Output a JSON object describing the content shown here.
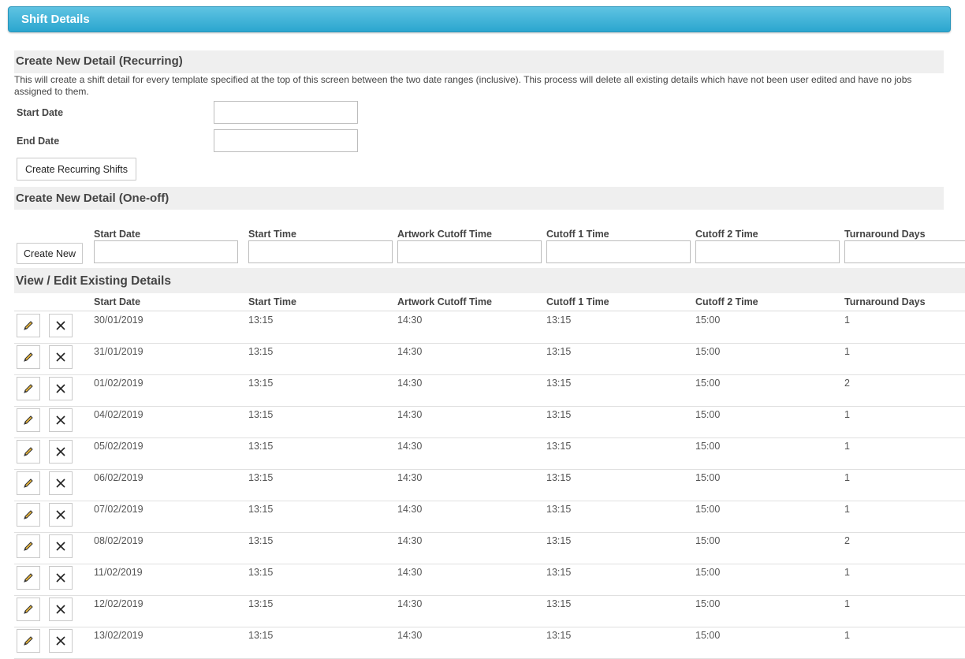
{
  "header": {
    "title": "Shift Details"
  },
  "recurring": {
    "title": "Create New Detail (Recurring)",
    "description": "This will create a shift detail for every template specified at the top of this screen between the two date ranges (inclusive). This process will delete all existing details which have not been user edited and have no jobs assigned to them.",
    "start_date_label": "Start Date",
    "end_date_label": "End Date",
    "start_date_value": "",
    "end_date_value": "",
    "create_button": "Create Recurring Shifts"
  },
  "oneoff": {
    "title": "Create New Detail (One-off)",
    "create_button": "Create New",
    "columns": [
      "Start Date",
      "Start Time",
      "Artwork Cutoff Time",
      "Cutoff 1 Time",
      "Cutoff 2 Time",
      "Turnaround Days"
    ],
    "values": [
      "",
      "",
      "",
      "",
      "",
      ""
    ]
  },
  "existing": {
    "title": "View / Edit Existing Details",
    "columns": [
      "Start Date",
      "Start Time",
      "Artwork Cutoff Time",
      "Cutoff 1 Time",
      "Cutoff 2 Time",
      "Turnaround Days"
    ],
    "rows": [
      [
        "30/01/2019",
        "13:15",
        "14:30",
        "13:15",
        "15:00",
        "1"
      ],
      [
        "31/01/2019",
        "13:15",
        "14:30",
        "13:15",
        "15:00",
        "1"
      ],
      [
        "01/02/2019",
        "13:15",
        "14:30",
        "13:15",
        "15:00",
        "2"
      ],
      [
        "04/02/2019",
        "13:15",
        "14:30",
        "13:15",
        "15:00",
        "1"
      ],
      [
        "05/02/2019",
        "13:15",
        "14:30",
        "13:15",
        "15:00",
        "1"
      ],
      [
        "06/02/2019",
        "13:15",
        "14:30",
        "13:15",
        "15:00",
        "1"
      ],
      [
        "07/02/2019",
        "13:15",
        "14:30",
        "13:15",
        "15:00",
        "1"
      ],
      [
        "08/02/2019",
        "13:15",
        "14:30",
        "13:15",
        "15:00",
        "2"
      ],
      [
        "11/02/2019",
        "13:15",
        "14:30",
        "13:15",
        "15:00",
        "1"
      ],
      [
        "12/02/2019",
        "13:15",
        "14:30",
        "13:15",
        "15:00",
        "1"
      ],
      [
        "13/02/2019",
        "13:15",
        "14:30",
        "13:15",
        "15:00",
        "1"
      ]
    ]
  }
}
